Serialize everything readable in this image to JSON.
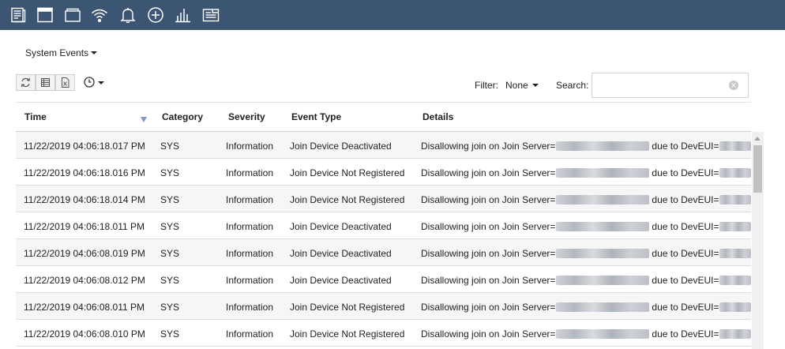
{
  "toolbar_icons": [
    "dashboard-icon",
    "window-icon",
    "tabs-icon",
    "wifi-icon",
    "bell-icon",
    "plus-circle-icon",
    "bar-chart-icon",
    "report-icon"
  ],
  "menu": {
    "title": "System Events"
  },
  "actions": [
    "refresh-icon",
    "csv-export-icon",
    "excel-export-icon",
    "clock-icon"
  ],
  "filter": {
    "label": "Filter:",
    "value": "None"
  },
  "search": {
    "label": "Search:",
    "value": ""
  },
  "columns": [
    "Time",
    "Category",
    "Severity",
    "Event Type",
    "Details"
  ],
  "sort": {
    "column": "Time",
    "direction": "descending"
  },
  "rows": [
    {
      "time": "11/22/2019 04:06:18.017 PM",
      "category": "SYS",
      "severity": "Information",
      "event_type": "Join Device Deactivated",
      "details_prefix": "Disallowing join on Join Server=",
      "details_middle": "due to DevEUI=",
      "details_suffix": "F"
    },
    {
      "time": "11/22/2019 04:06:18.016 PM",
      "category": "SYS",
      "severity": "Information",
      "event_type": "Join Device Not Registered",
      "details_prefix": "Disallowing join on Join Server=",
      "details_middle": "due to DevEUI=",
      "details_suffix": "F"
    },
    {
      "time": "11/22/2019 04:06:18.014 PM",
      "category": "SYS",
      "severity": "Information",
      "event_type": "Join Device Not Registered",
      "details_prefix": "Disallowing join on Join Server=",
      "details_middle": "due to DevEUI=",
      "details_suffix": "F"
    },
    {
      "time": "11/22/2019 04:06:18.011 PM",
      "category": "SYS",
      "severity": "Information",
      "event_type": "Join Device Deactivated",
      "details_prefix": "Disallowing join on Join Server=",
      "details_middle": "due to DevEUI=",
      "details_suffix": "F"
    },
    {
      "time": "11/22/2019 04:06:08.019 PM",
      "category": "SYS",
      "severity": "Information",
      "event_type": "Join Device Deactivated",
      "details_prefix": "Disallowing join on Join Server=",
      "details_middle": "due to DevEUI=",
      "details_suffix": "F"
    },
    {
      "time": "11/22/2019 04:06:08.012 PM",
      "category": "SYS",
      "severity": "Information",
      "event_type": "Join Device Deactivated",
      "details_prefix": "Disallowing join on Join Server=",
      "details_middle": "due to DevEUI=",
      "details_suffix": "F"
    },
    {
      "time": "11/22/2019 04:06:08.011 PM",
      "category": "SYS",
      "severity": "Information",
      "event_type": "Join Device Not Registered",
      "details_prefix": "Disallowing join on Join Server=",
      "details_middle": "due to DevEUI=",
      "details_suffix": "F"
    },
    {
      "time": "11/22/2019 04:06:08.010 PM",
      "category": "SYS",
      "severity": "Information",
      "event_type": "Join Device Not Registered",
      "details_prefix": "Disallowing join on Join Server=",
      "details_middle": "due to DevEUI=",
      "details_suffix": "F"
    }
  ],
  "colors": {
    "topbar": "#3c5572",
    "row_alt": "#f6f6f6",
    "sort_arrow": "#7f96c9"
  }
}
